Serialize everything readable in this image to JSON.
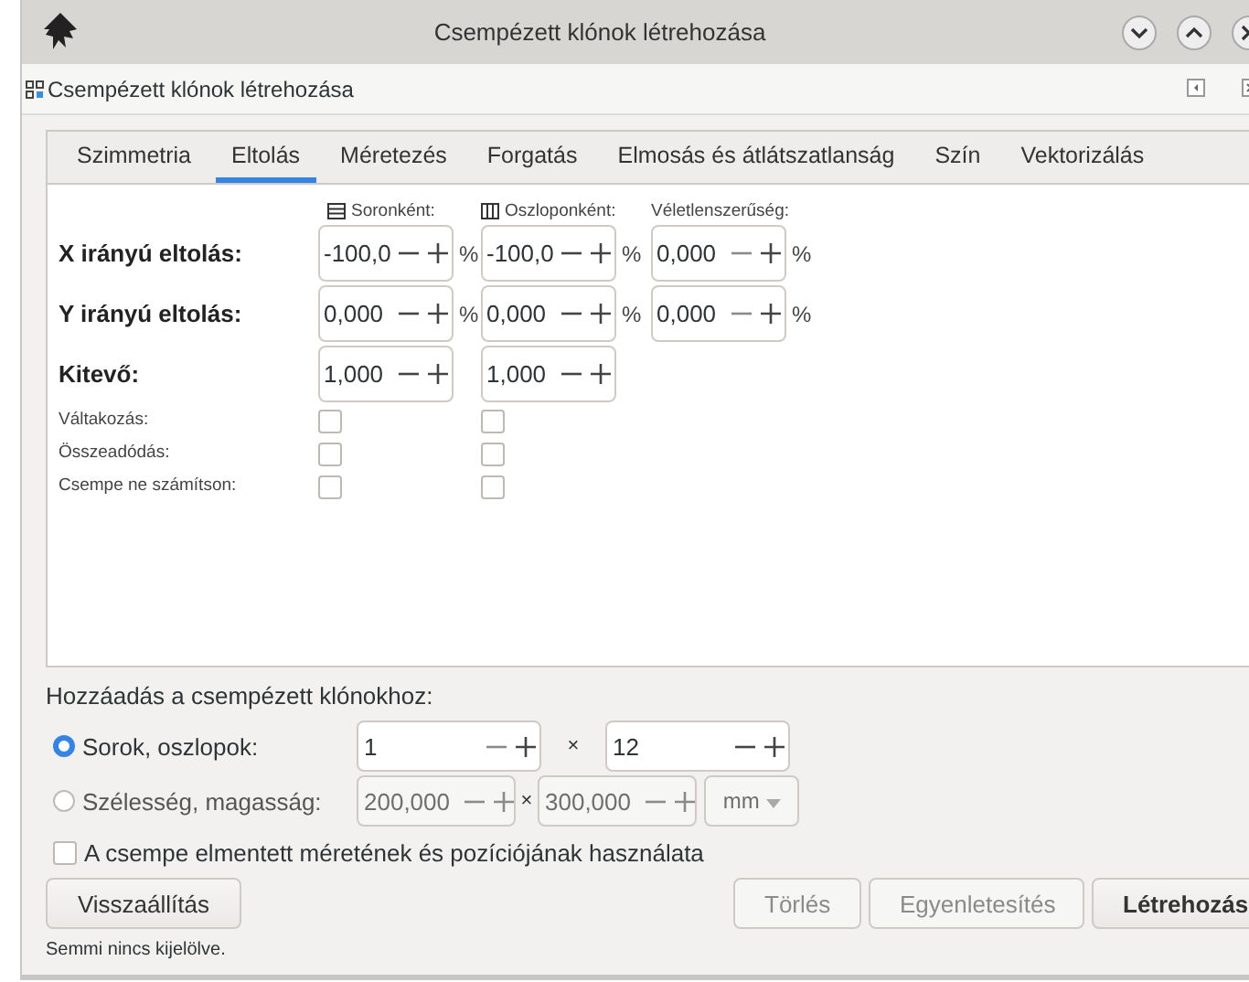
{
  "window": {
    "title": "Csempézett klónok létrehozása"
  },
  "panel": {
    "title": "Csempézett klónok létrehozása"
  },
  "tabs": [
    {
      "label": "Szimmetria",
      "selected": false
    },
    {
      "label": "Eltolás",
      "selected": true
    },
    {
      "label": "Méretezés",
      "selected": false
    },
    {
      "label": "Forgatás",
      "selected": false
    },
    {
      "label": "Elmosás és átlátszatlanság",
      "selected": false
    },
    {
      "label": "Szín",
      "selected": false
    },
    {
      "label": "Vektorizálás",
      "selected": false
    }
  ],
  "columns": [
    {
      "label": "Soronként:"
    },
    {
      "label": "Oszloponként:"
    },
    {
      "label": "Véletlenszerűség:"
    }
  ],
  "value_rows": [
    {
      "label": "X irányú eltolás:",
      "fields": [
        {
          "value": "-100,0",
          "unit": "%",
          "minus_disabled": false
        },
        {
          "value": "-100,0",
          "unit": "%",
          "minus_disabled": false
        },
        {
          "value": "0,000",
          "unit": "%",
          "minus_disabled": true
        }
      ]
    },
    {
      "label": "Y irányú eltolás:",
      "fields": [
        {
          "value": "0,000",
          "unit": "%",
          "minus_disabled": false
        },
        {
          "value": "0,000",
          "unit": "%",
          "minus_disabled": false
        },
        {
          "value": "0,000",
          "unit": "%",
          "minus_disabled": true
        }
      ]
    },
    {
      "label": "Kitevő:",
      "fields": [
        {
          "value": "1,000",
          "minus_disabled": false
        },
        {
          "value": "1,000",
          "minus_disabled": false
        }
      ]
    }
  ],
  "check_rows": [
    {
      "label": "Váltakozás:",
      "checks": [
        {
          "checked": false
        },
        {
          "checked": false
        }
      ]
    },
    {
      "label": "Összeadódás:",
      "checks": [
        {
          "checked": false
        },
        {
          "checked": false
        }
      ]
    },
    {
      "label": "Csempe ne számítson:",
      "checks": [
        {
          "checked": false
        },
        {
          "checked": false
        }
      ]
    }
  ],
  "add_section": {
    "title": "Hozzáadás a csempézett klónokhoz:",
    "options": [
      {
        "label": "Sorok, oszlopok:",
        "selected": true,
        "disabled": false,
        "separator": "×",
        "fields": [
          {
            "value": "1",
            "minus_disabled": true
          },
          {
            "value": "12",
            "minus_disabled": false
          }
        ]
      },
      {
        "label": "Szélesség, magasság:",
        "selected": false,
        "disabled": true,
        "separator": "×",
        "fields": [
          {
            "value": "200,000",
            "minus_disabled": true
          },
          {
            "value": "300,000",
            "minus_disabled": true
          }
        ],
        "unit": "mm"
      }
    ]
  },
  "use_saved": {
    "label": "A csempe elmentett méretének és pozíciójának használata",
    "checked": false
  },
  "buttons": [
    {
      "label": "Visszaállítás",
      "disabled": false,
      "primary": false
    },
    {
      "label": "Törlés",
      "disabled": true,
      "primary": false
    },
    {
      "label": "Egyenletesítés",
      "disabled": true,
      "primary": false
    },
    {
      "label": "Létrehozás",
      "disabled": false,
      "primary": true
    }
  ],
  "status": "Semmi nincs kijelölve."
}
